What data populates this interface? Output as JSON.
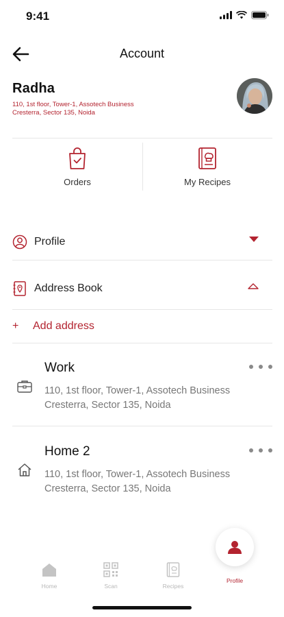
{
  "status_bar": {
    "time": "9:41"
  },
  "header": {
    "title": "Account"
  },
  "user": {
    "name": "Radha",
    "address": "110, 1st floor, Tower-1, Assotech Business Cresterra, Sector 135, Noida"
  },
  "quick_actions": [
    {
      "label": "Orders",
      "icon": "shopping-bag-icon"
    },
    {
      "label": "My Recipes",
      "icon": "recipe-book-icon"
    }
  ],
  "sections": {
    "profile": {
      "label": "Profile",
      "icon": "user-circle-icon",
      "expanded": false
    },
    "address_book": {
      "label": "Address Book",
      "icon": "address-book-icon",
      "expanded": true
    }
  },
  "add_address": {
    "plus": "+",
    "label": "Add address"
  },
  "addresses": [
    {
      "title": "Work",
      "icon": "briefcase-icon",
      "address": "110, 1st floor, Tower-1, Assotech Business Cresterra, Sector 135, Noida"
    },
    {
      "title": "Home 2",
      "icon": "home-icon",
      "address": "110, 1st floor, Tower-1, Assotech Business Cresterra, Sector 135, Noida"
    }
  ],
  "tabs": [
    {
      "label": "Home",
      "icon": "home-tab-icon",
      "active": false
    },
    {
      "label": "Scan",
      "icon": "qr-code-icon",
      "active": false
    },
    {
      "label": "Recipes",
      "icon": "recipes-tab-icon",
      "active": false
    },
    {
      "label": "Profile",
      "icon": "profile-tab-icon",
      "active": true
    }
  ],
  "colors": {
    "accent": "#b3232f",
    "muted": "#777777",
    "inactive_tab": "#b8b8b8"
  }
}
